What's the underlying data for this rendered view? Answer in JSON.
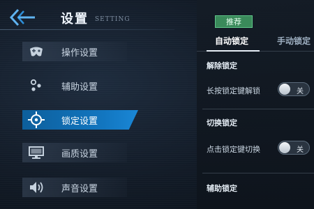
{
  "header": {
    "back_icon": "back-arrow-icon",
    "title": "设置",
    "subtitle": "SETTING"
  },
  "sidebar": {
    "items": [
      {
        "label": "操作设置",
        "icon": "gamepad-icon",
        "active": false
      },
      {
        "label": "辅助设置",
        "icon": "dots-icon",
        "active": false
      },
      {
        "label": "锁定设置",
        "icon": "crosshair-icon",
        "active": true
      },
      {
        "label": "画质设置",
        "icon": "monitor-icon",
        "active": false
      },
      {
        "label": "声音设置",
        "icon": "speaker-icon",
        "active": false
      }
    ]
  },
  "panel": {
    "tag": "推荐",
    "tabs": [
      {
        "label": "自动锁定",
        "active": true
      },
      {
        "label": "手动锁定",
        "active": false
      }
    ],
    "sections": [
      {
        "title": "解除锁定",
        "row_label": "长按锁定键解锁",
        "toggle": "关"
      },
      {
        "title": "切换锁定",
        "row_label": "点击锁定键切换",
        "toggle": "关"
      },
      {
        "title": "辅助锁定"
      }
    ]
  },
  "colors": {
    "accent": "#1276c0",
    "tag_green": "#3a8a5a"
  }
}
